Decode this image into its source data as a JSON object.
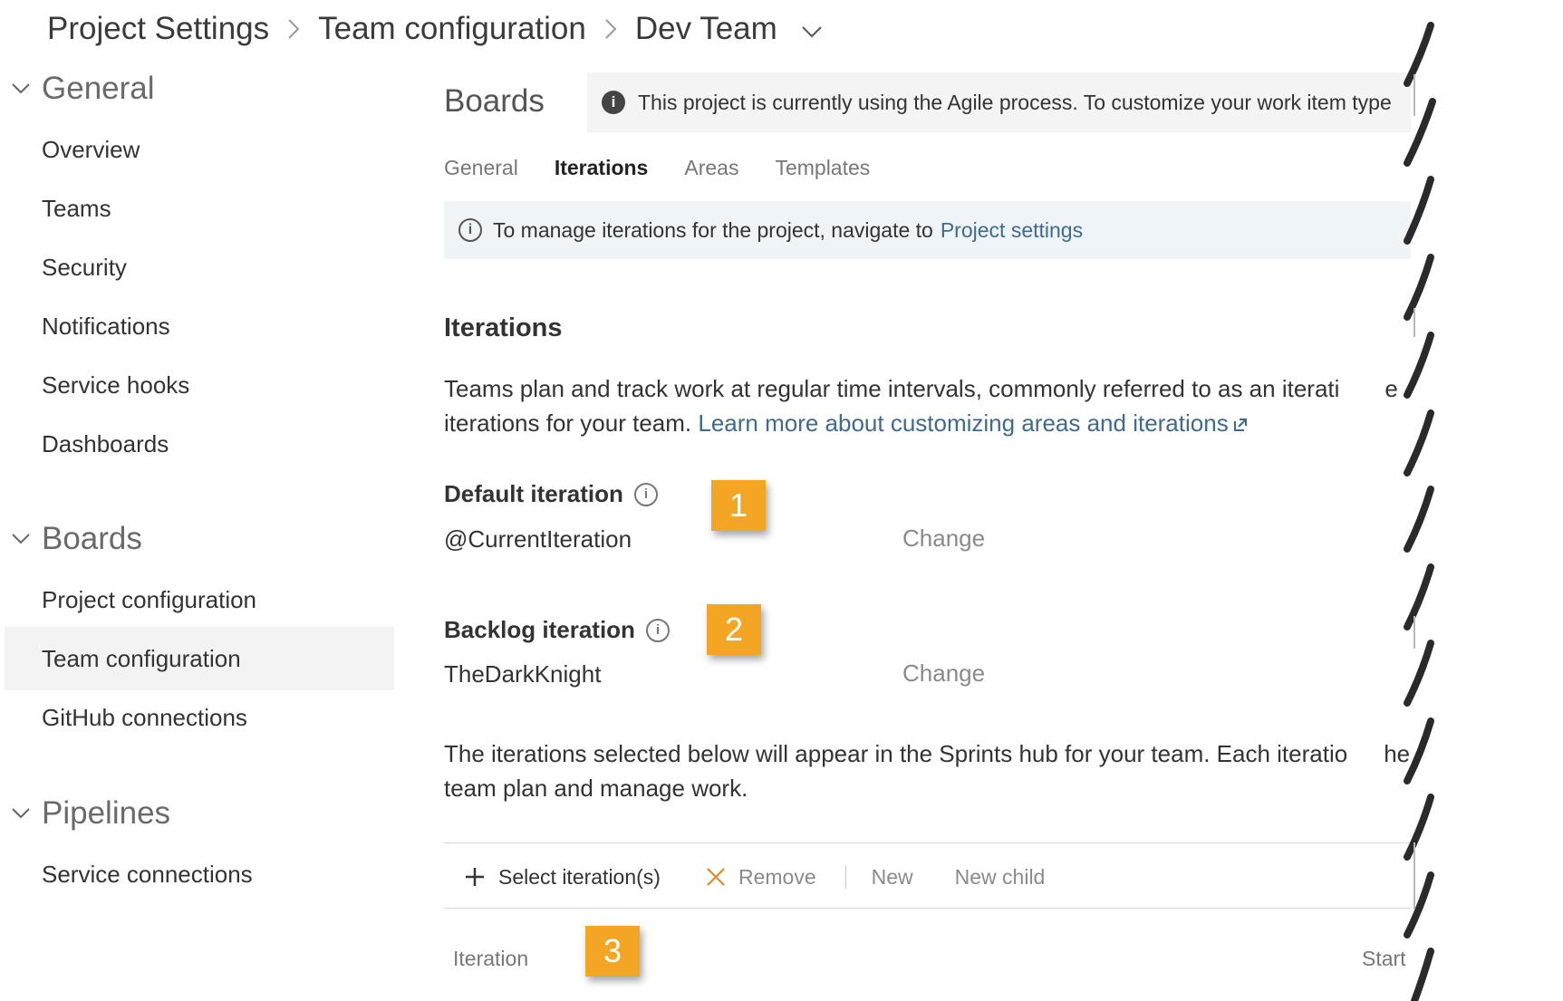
{
  "breadcrumb": {
    "items": [
      "Project Settings",
      "Team configuration",
      "Dev Team"
    ]
  },
  "sidebar": {
    "groups": [
      {
        "label": "General",
        "items": [
          "Overview",
          "Teams",
          "Security",
          "Notifications",
          "Service hooks",
          "Dashboards"
        ]
      },
      {
        "label": "Boards",
        "items": [
          "Project configuration",
          "Team configuration",
          "GitHub connections"
        ]
      },
      {
        "label": "Pipelines",
        "items": [
          "Service connections"
        ]
      }
    ],
    "selected": "Team configuration"
  },
  "main": {
    "title": "Boards",
    "banner": "This project is currently using the Agile process. To customize your work item type",
    "tabs": [
      "General",
      "Iterations",
      "Areas",
      "Templates"
    ],
    "active_tab": "Iterations",
    "message": {
      "text": "To manage iterations for the project, navigate to",
      "link": "Project settings"
    },
    "section_title": "Iterations",
    "intro": {
      "line1": "Teams plan and track work at regular time intervals, commonly referred to as an iterati",
      "line1_tail": "e",
      "line2": "iterations for your team.",
      "link": "Learn more about customizing areas and iterations"
    },
    "default_iteration": {
      "label": "Default iteration",
      "value": "@CurrentIteration",
      "action": "Change"
    },
    "backlog_iteration": {
      "label": "Backlog iteration",
      "value": "TheDarkKnight",
      "action": "Change"
    },
    "sprints_note": {
      "line1": "The iterations selected below will appear in the Sprints hub for your team. Each iteratio",
      "line1_tail": "help your",
      "line2": "team plan and manage work."
    },
    "toolbar": {
      "select": "Select iteration(s)",
      "remove": "Remove",
      "new": "New",
      "new_child": "New child"
    },
    "columns": {
      "iteration": "Iteration",
      "start": "Start D"
    }
  },
  "callouts": [
    "1",
    "2",
    "3"
  ],
  "colors": {
    "callout": "#f3a623",
    "link": "#3f6a8f",
    "message_bg": "#eff4f8",
    "selected_nav_bg": "#f3f3f3"
  }
}
